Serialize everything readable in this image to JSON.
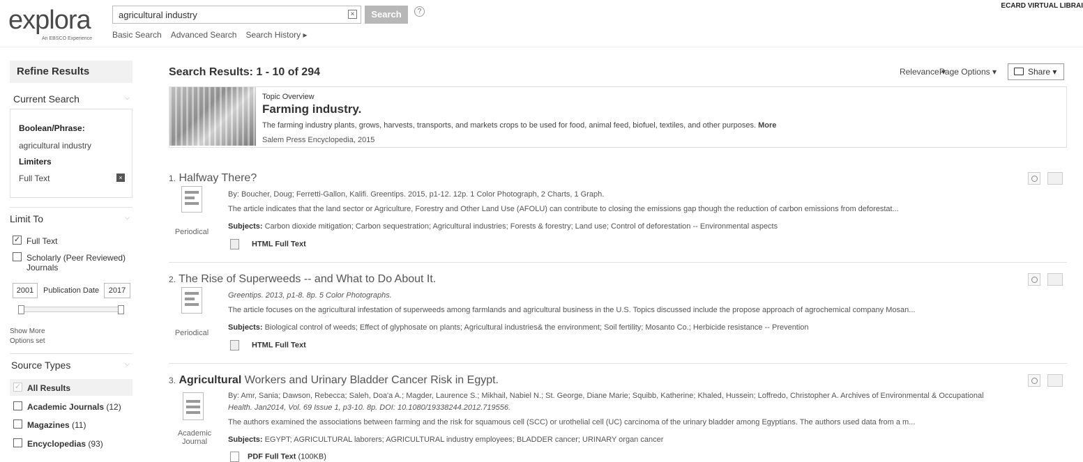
{
  "header": {
    "logo_word": "explora",
    "logo_sub": "An EBSCO Experience",
    "search_value": "agricultural industry",
    "search_button": "Search",
    "help_symbol": "?",
    "links": [
      "Basic Search",
      "Advanced Search",
      "Search History ▸"
    ],
    "institution": "ECARD VIRTUAL LIBRAI"
  },
  "sidebar": {
    "refine_title": "Refine Results",
    "current_search_title": "Current Search",
    "boolean_label": "Boolean/Phrase:",
    "boolean_value": "agricultural industry",
    "limiters_label": "Limiters",
    "limiter_value": "Full Text",
    "limit_to_title": "Limit To",
    "limit_items": [
      {
        "label": "Full Text",
        "checked": true
      },
      {
        "label": "Scholarly (Peer Reviewed)",
        "label2": "Journals",
        "checked": false
      }
    ],
    "date_from": "2001",
    "date_label": "Publication Date",
    "date_to": "2017",
    "show_more": "Show More",
    "options_set": "Options set",
    "source_types_title": "Source Types",
    "source_items": [
      {
        "label": "All Results",
        "count": "",
        "checked": true
      },
      {
        "label": "Academic Journals",
        "count": "(12)",
        "checked": false
      },
      {
        "label": "Magazines",
        "count": "(11)",
        "checked": false
      },
      {
        "label": "Encyclopedias",
        "count": "(93)",
        "checked": false
      }
    ]
  },
  "main": {
    "results_title": "Search Results: 1 - 10 of 294",
    "relevance": "Relevance ▾",
    "page_options": "Page Options ▾",
    "share": "Share ▾",
    "topic": {
      "label": "Topic Overview",
      "title": "Farming industry.",
      "desc": "The farming industry plants, grows, harvests, transports, and markets crops to be used for food, animal feed, biofuel, textiles, and other purposes.",
      "more": "More",
      "source": "Salem Press Encyclopedia, 2015"
    },
    "results": [
      {
        "num": "1.",
        "title": "Halfway There?",
        "type": "Periodical",
        "by": "By: Boucher, Doug; Ferretti-Gallon, Kalifi. Greentips. 2015, p1-12. 12p. 1 Color Photograph, 2 Charts, 1 Graph.",
        "desc": "The article indicates that the land sector or Agriculture, Forestry and Other Land Use (AFOLU) can contribute to closing the emissions gap though the reduction of carbon emissions from deforestat...",
        "subjects_label": "Subjects:",
        "subjects": "Carbon dioxide mitigation; Carbon sequestration; Agricultural industries; Forests & forestry; Land use; Control of deforestation -- Environmental aspects",
        "link": "HTML Full Text"
      },
      {
        "num": "2.",
        "title": "The Rise of Superweeds -- and What to Do About It.",
        "type": "Periodical",
        "by": "Greentips. 2013, p1-8. 8p. 5 Color Photographs.",
        "desc": "The article focuses on the agricultural infestation of superweeds among farmlands and agricultural business in the U.S. Topics discussed include the propose approach of agrochemical company Mosan...",
        "subjects_label": "Subjects:",
        "subjects": "Biological control of weeds; Effect of glyphosate on plants; Agricultural industries& the environment; Soil fertility; Mosanto Co.; Herbicide resistance -- Prevention",
        "link": "HTML Full Text"
      },
      {
        "num": "3.",
        "title_bold": "Agricultural",
        "title": " Workers and Urinary Bladder Cancer Risk in Egypt.",
        "type": "Academic",
        "type2": "Journal",
        "by": "By: Amr, Sania; Dawson, Rebecca; Saleh, Doa'a A.; Magder, Laurence S.; Mikhail, Nabiel N.; St. George, Diane Marie; Squibb, Katherine; Khaled, Hussein; Loffredo, Christopher A. Archives of Environmental & Occupational",
        "by2": "Health. Jan2014, Vol. 69 Issue 1, p3-10. 8p. DOI: 10.1080/19338244.2012.719556.",
        "desc": "The authors examined the associations between farming and the risk for squamous cell (SCC) or urothelial cell (UC) carcinoma of the urinary bladder among Egyptians. The authors used data from a m...",
        "subjects_label": "Subjects:",
        "subjects": "EGYPT; AGRICULTURAL laborers; AGRICULTURAL industry employees; BLADDER cancer; URINARY organ cancer",
        "link": "PDF Full Text",
        "link_size": "(100KB)"
      }
    ]
  },
  "colors": {
    "search_button": "#b7b7b7",
    "panel_bg": "#f1f1f1",
    "border": "#e2e2e2"
  }
}
